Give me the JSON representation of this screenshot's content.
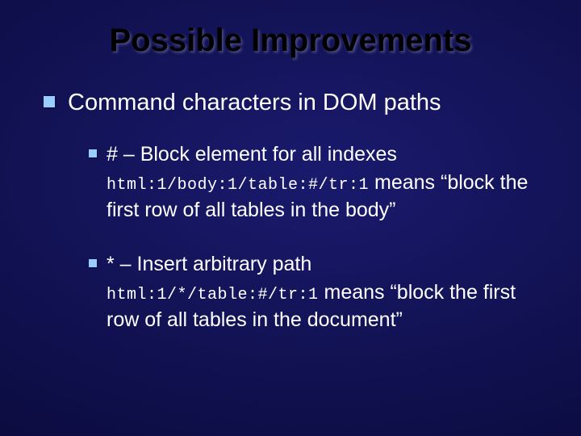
{
  "title": "Possible Improvements",
  "level1": {
    "text": "Command characters in DOM paths"
  },
  "items": [
    {
      "head": "# – Block element for all indexes",
      "code": "html:1/body:1/table:#/tr:1",
      "tail": " means “block the first row of all tables in the body”"
    },
    {
      "head": "* – Insert arbitrary path",
      "code": "html:1/*/table:#/tr:1",
      "tail": " means “block the first row of all tables in the document”"
    }
  ]
}
